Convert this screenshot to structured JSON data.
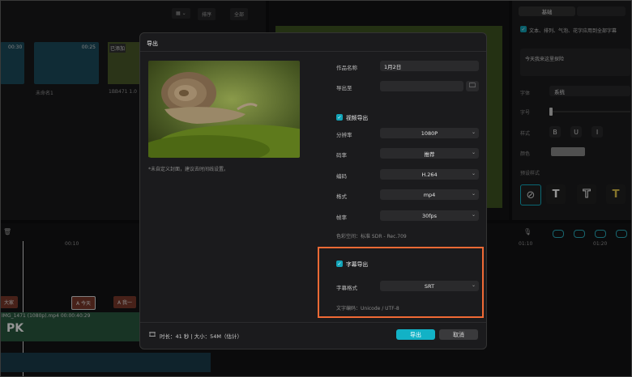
{
  "background": {
    "media": {
      "sort_label": "排序",
      "all_label": "全部",
      "clips": [
        {
          "time": "00:30"
        },
        {
          "time": "00:25",
          "name": "未命名1"
        },
        {
          "name": "1BB471 1.0"
        }
      ],
      "added_tag": "已添加"
    },
    "inspector": {
      "tabs": [
        "基础",
        ""
      ],
      "apply_label": "文本、排列、气泡、花字应用到全部字幕",
      "text_content": "今天我来这里探险",
      "font_label": "字体",
      "font_value": "系统",
      "size_label": "字号",
      "style_label": "样式",
      "style_buttons": [
        "B",
        "U",
        "I"
      ],
      "color_label": "颜色",
      "preset_label": "预设样式"
    },
    "timeline": {
      "ruler": [
        "00:10",
        "01:10",
        "01:20"
      ],
      "track_name": "PK",
      "clip_info": "IMG_1471 (1080p).mp4  00:00:40:29",
      "subtitle_chips": [
        "大家",
        "A 今天",
        "A 我一"
      ],
      "track2_label": "2"
    }
  },
  "dialog": {
    "title": "导出",
    "cover_hint": "*未自定义封面，建议去时间线设置。",
    "name_label": "作品名称",
    "name_value": "1月2日",
    "export_to_label": "导出至",
    "export_to_value": "",
    "video_section": "视频导出",
    "rows": [
      {
        "label": "分辨率",
        "value": "1080P"
      },
      {
        "label": "码率",
        "value": "推荐"
      },
      {
        "label": "编码",
        "value": "H.264"
      },
      {
        "label": "格式",
        "value": "mp4"
      },
      {
        "label": "帧率",
        "value": "30fps"
      }
    ],
    "color_space": "色彩空间：标准 SDR - Rec.709",
    "subtitle_section": "字幕导出",
    "subtitle_format_label": "字幕格式",
    "subtitle_format_value": "SRT",
    "encoding_note": "文字编码：Unicode / UTF-8",
    "duration_info": "时长：41 秒 | 大小：54M（估计）",
    "export_button": "导出",
    "cancel_button": "取消"
  },
  "colors": {
    "accent": "#12b2c6",
    "highlight": "#f06a35"
  }
}
